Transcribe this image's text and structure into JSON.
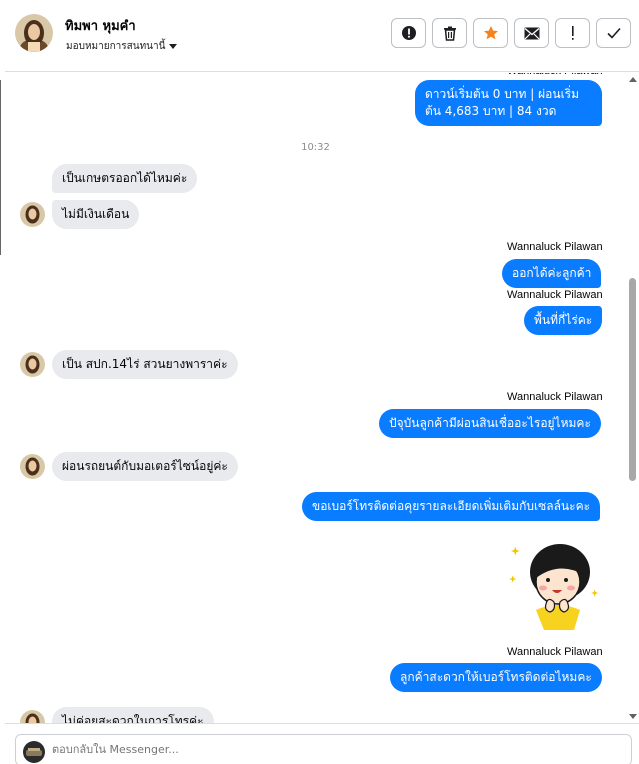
{
  "header": {
    "name": "ทิมพา หุมคำ",
    "assign_label": "มอบหมายการสนทนานี้",
    "actions": [
      "alert-circle-icon",
      "trash-icon",
      "star-icon",
      "mail-icon",
      "exclamation-icon",
      "check-icon"
    ]
  },
  "messages": {
    "sender_name": "Wannaluck Pilawan",
    "m1": "ดาวน์เริ่มต้น 0 บาท | ผ่อนเริ่มต้น 4,683  บาท | 84 งวด",
    "time": "10:32",
    "m2": "เป็นเกษตรออกได้ไหมค่ะ",
    "m3": "ไม่มีเงินเดือน",
    "m4": "ออกได้ค่ะลูกค้า",
    "m5": "พื้นที่กี่ไร่คะ",
    "m6": "เป็น สปก.14ไร่ สวนยางพาราค่ะ",
    "m7": "ปัจุบันลูกค้ามีผ่อนสินเชื่ออะไรอยู่ไหมคะ",
    "m8": "ผ่อนรถยนต์กับมอเตอร์ไซน์อยู่ค่ะ",
    "m9": "ขอเบอร์โทรติดต่อคุยรายละเอียดเพิ่มเติมกับเซลล์นะคะ",
    "m10": "ลูกค้าสะดวกให้เบอร์โทรติดต่อไหมคะ",
    "m11": "ไม่ค่อยสะดวกในการโทรค่ะ"
  },
  "composer": {
    "placeholder": "ตอบกลับใน Messenger..."
  },
  "colors": {
    "outgoing": "#0a7cff",
    "incoming": "#e9eaed",
    "star": "#f5821f"
  }
}
